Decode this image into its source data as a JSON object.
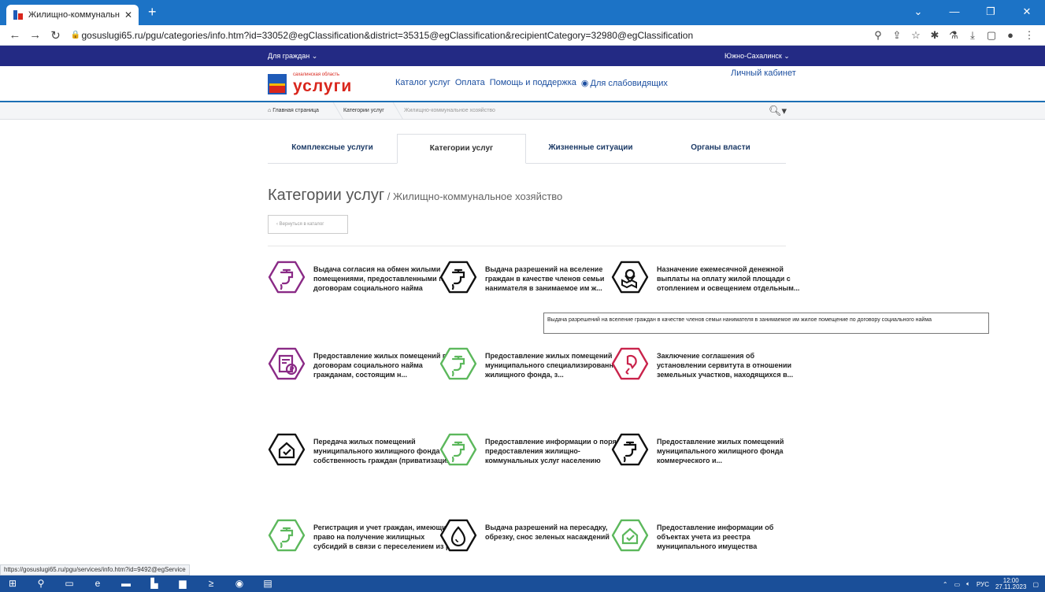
{
  "browser": {
    "tab_title": "Жилищно-коммунальное хозя...",
    "url": "gosuslugi65.ru/pgu/categories/info.htm?id=33052@egClassification&district=35315@egClassification&recipientCategory=32980@egClassification"
  },
  "site": {
    "for_citizens": "Для граждан",
    "city": "Южно-Сахалинск",
    "logo_region": "сахалинская область",
    "logo_name": "услуги",
    "nav": [
      "Каталог услуг",
      "Оплата",
      "Помощь и поддержка",
      "Для слабовидящих"
    ],
    "cabinet": "Личный кабинет",
    "breadcrumb": [
      "Главная страница",
      "Категории услуг",
      "Жилищно-коммунальное хозяйство"
    ]
  },
  "tabs": [
    "Комплексные услуги",
    "Категории услуг",
    "Жизненные ситуации",
    "Органы власти"
  ],
  "page": {
    "title": "Категории услуг",
    "sep": " / ",
    "subtitle": "Жилищно-коммунальное хозяйство",
    "back": "Вернуться в каталог"
  },
  "services": [
    {
      "text": "Выдача согласия на обмен жилыми помещениями, предоставленными по договорам социального найма",
      "color": "#8a2a86",
      "icon": "tap-icon"
    },
    {
      "text": "Выдача разрешений на вселение граждан в качестве членов семьи нанимателя в занимаемое им ж...",
      "color": "#111111",
      "icon": "tap-icon"
    },
    {
      "text": "Назначение ежемесячной денежной выплаты на оплату жилой площади с отоплением и освещением отдельным...",
      "color": "#111111",
      "icon": "map-icon"
    },
    {
      "text": "Предоставление жилых помещений по договорам социального найма гражданам, состоящим н...",
      "color": "#8a2a86",
      "icon": "document-ruble-icon"
    },
    {
      "text": "Предоставление жилых помещений муниципального специализированного жилищного фонда, з...",
      "color": "#5cb85c",
      "icon": "tap-icon"
    },
    {
      "text": "Заключение соглашения об установлении сервитута в отношении земельных участков, находящихся в...",
      "color": "#c9234b",
      "icon": "location-pin-icon"
    },
    {
      "text": "Передача жилых помещений муниципального жилищного фонда в собственность граждан (приватизация)",
      "color": "#111111",
      "icon": "house-check-icon"
    },
    {
      "text": "Предоставление информации о порядке предоставления жилищно-коммунальных услуг населению",
      "color": "#5cb85c",
      "icon": "tap-icon"
    },
    {
      "text": "Предоставление жилых помещений муниципального жилищного фонда коммерческого и...",
      "color": "#111111",
      "icon": "tap-icon"
    },
    {
      "text": "Регистрация и учет граждан, имеющих право на получение жилищных субсидий в связи с переселением из р...",
      "color": "#5cb85c",
      "icon": "tap-icon"
    },
    {
      "text": "Выдача разрешений на пересадку, обрезку, снос зеленых насаждений",
      "color": "#111111",
      "icon": "water-drop-icon"
    },
    {
      "text": "Предоставление информации об объектах учета из реестра муниципального имущества",
      "color": "#5cb85c",
      "icon": "house-check-icon"
    }
  ],
  "tooltip": "Выдача разрешений на вселение граждан в качестве членов семьи нанимателя в занимаемое им жилое помещение по договору социального найма",
  "status_url": "https://gosuslugi65.ru/pgu/services/info.htm?id=9492@egService",
  "taskbar": {
    "lang": "РУС",
    "time": "12:00",
    "date": "27.11.2023"
  }
}
